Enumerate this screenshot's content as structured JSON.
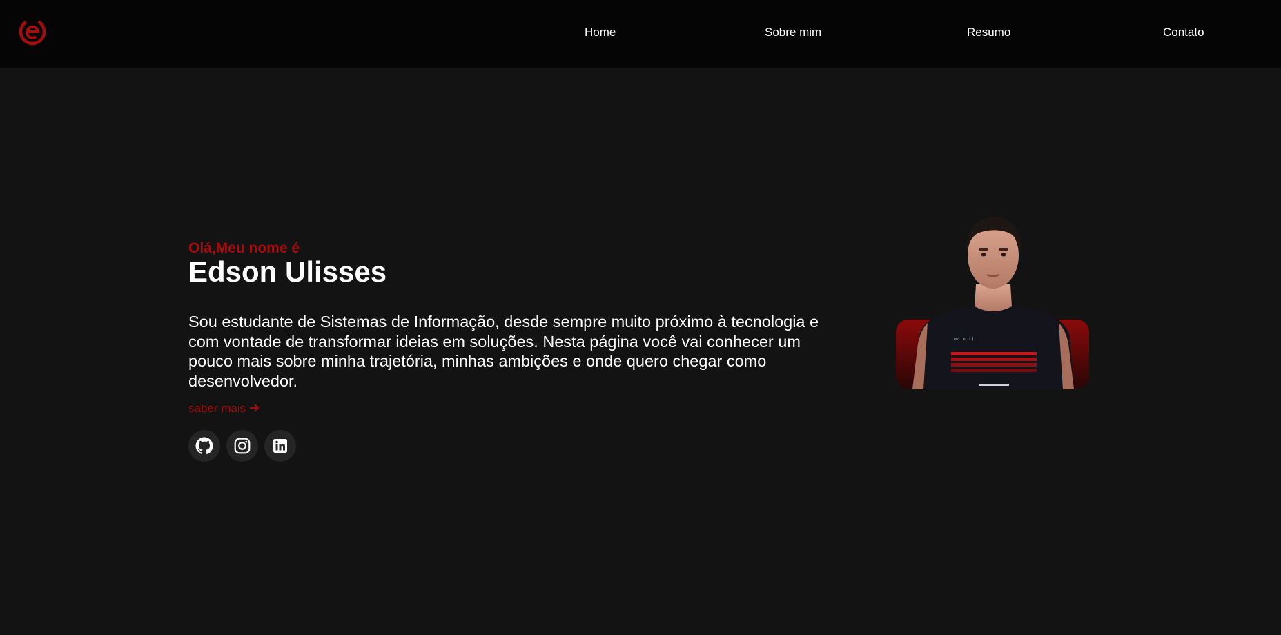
{
  "nav": {
    "links": [
      "Home",
      "Sobre mim",
      "Resumo",
      "Contato"
    ]
  },
  "hero": {
    "greeting": "Olá,Meu nome é",
    "name": "Edson Ulisses",
    "bio": "Sou estudante de Sistemas de Informação, desde sempre muito próximo à tecnologia e com vontade de transformar ideias em soluções. Nesta página você vai conhecer um pouco mais sobre minha trajetória, minhas ambições e onde quero chegar como desenvolvedor.",
    "more_label": "saber mais",
    "more_icon": "arrow-right-icon",
    "social": [
      {
        "name": "github-button",
        "icon": "github-icon"
      },
      {
        "name": "instagram-button",
        "icon": "instagram-icon"
      },
      {
        "name": "linkedin-button",
        "icon": "linkedin-icon"
      }
    ]
  },
  "photo": {
    "shirt_text": "main ()"
  },
  "colors": {
    "accent": "#a50d0d",
    "nav_bg": "#050505",
    "page_bg": "#131313",
    "text": "#ffffff"
  }
}
